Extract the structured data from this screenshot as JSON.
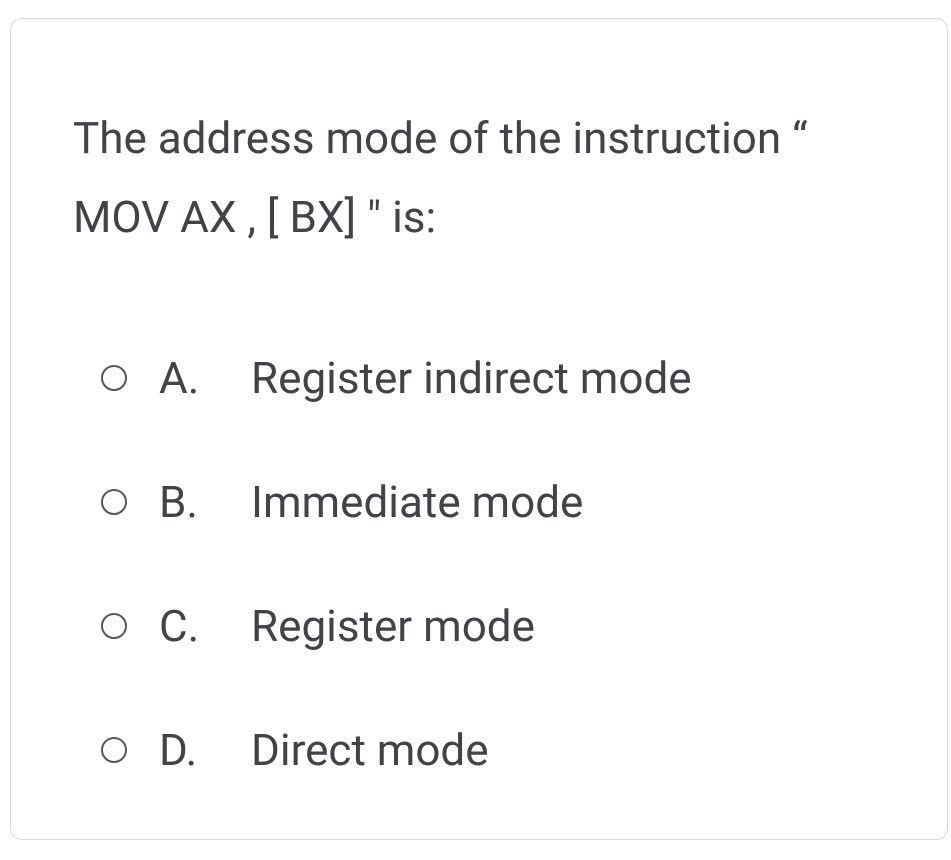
{
  "question": {
    "text": "The address mode of the instruction “ MOV  AX , [ BX] \" is:"
  },
  "options": [
    {
      "letter": "A.",
      "text": "Register indirect mode"
    },
    {
      "letter": "B.",
      "text": "Immediate mode"
    },
    {
      "letter": "C.",
      "text": "Register mode"
    },
    {
      "letter": "D.",
      "text": "Direct mode"
    }
  ]
}
